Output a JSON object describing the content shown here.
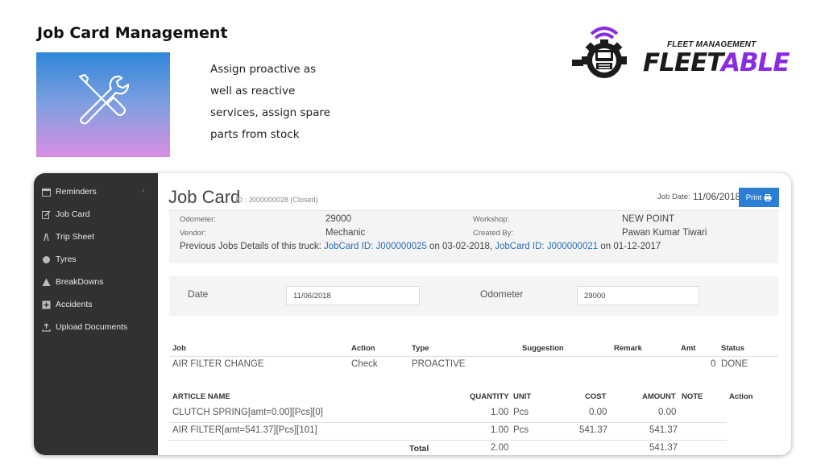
{
  "slide": {
    "title": "Job Card Management",
    "description": "Assign proactive as well as reactive services, assign spare parts from stock"
  },
  "logo": {
    "tagline": "FLEET MANAGEMENT",
    "word_dark": "FLEET",
    "word_accent": "ABLE",
    "colors": {
      "dark": "#1b1b1b",
      "accent": "#8a2be2"
    }
  },
  "sidebar": {
    "items": [
      {
        "label": "Reminders",
        "icon": "calendar-icon"
      },
      {
        "label": "Job Card",
        "icon": "edit-icon"
      },
      {
        "label": "Trip Sheet",
        "icon": "road-icon"
      },
      {
        "label": "Tyres",
        "icon": "circle-icon"
      },
      {
        "label": "BreakDowns",
        "icon": "warning-icon"
      },
      {
        "label": "Accidents",
        "icon": "plus-square-icon"
      },
      {
        "label": "Upload Documents",
        "icon": "upload-icon"
      }
    ]
  },
  "jobcard": {
    "title": "Job Card",
    "id_text": "ID : J000000028 (Closed)",
    "job_date_label": "Job Date:",
    "job_date": "11/06/2018",
    "print_label": "Print",
    "odometer_label": "Odometer:",
    "odometer": "29000",
    "vendor_label": "Vendor:",
    "vendor": "Mechanic",
    "workshop_label": "Workshop:",
    "workshop": "NEW POINT",
    "created_by_label": "Created By:",
    "created_by": "Pawan Kumar Tiwari",
    "prev_label": "Previous Jobs Details of this truck:",
    "prev_link1": "JobCard ID: J000000025",
    "prev_on1": "on 03-02-2018,",
    "prev_link2": "JobCard ID: J000000021",
    "prev_on2": "on 01-12-2017"
  },
  "form": {
    "date_label": "Date",
    "date_value": "11/06/2018",
    "odometer_label": "Odometer",
    "odometer_value": "29000"
  },
  "jobs_table": {
    "headers": [
      "Job",
      "Action",
      "Type",
      "Suggestion",
      "Remark",
      "Amt",
      "Status"
    ],
    "rows": [
      {
        "job": "AIR FILTER CHANGE",
        "action": "Check",
        "type": "PROACTIVE",
        "suggestion": "",
        "remark": "",
        "amt": "0",
        "status": "DONE"
      }
    ]
  },
  "articles_table": {
    "headers": [
      "ARTICLE NAME",
      "QUANTITY",
      "UNIT",
      "COST",
      "AMOUNT",
      "NOTE",
      "Action"
    ],
    "rows": [
      {
        "name": "CLUTCH SPRING[amt=0.00][Pcs][0]",
        "quantity": "1.00",
        "unit": "Pcs",
        "cost": "0.00",
        "amount": "0.00"
      },
      {
        "name": "AIR FILTER[amt=541.37][Pcs][101]",
        "quantity": "1.00",
        "unit": "Pcs",
        "cost": "541.37",
        "amount": "541.37"
      }
    ],
    "total_label": "Total",
    "total_quantity": "2.00",
    "total_amount": "541.37"
  }
}
